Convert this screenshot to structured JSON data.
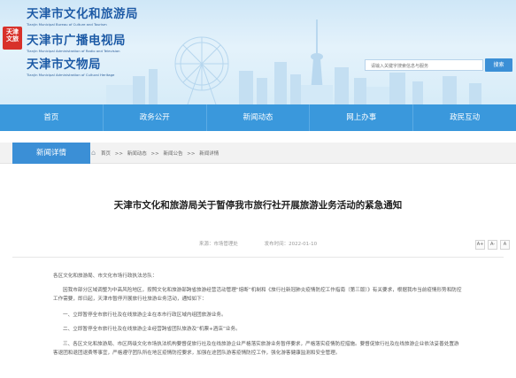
{
  "header": {
    "seal_text": "天津市文化和旅游局",
    "orgs": [
      {
        "cn": "天津市文化和旅游局",
        "en": "Tianjin Municipal Bureau of Culture and Tourism"
      },
      {
        "cn": "天津市广播电视局",
        "en": "Tianjin Municipal Administration of Radio and Television"
      },
      {
        "cn": "天津市文物局",
        "en": "Tianjin Municipal Administration of Cultural Heritage"
      }
    ],
    "search_placeholder": "请输入关键字搜索信息与服务",
    "search_button": "搜索"
  },
  "nav": {
    "items": [
      "首页",
      "政务公开",
      "新闻动态",
      "网上办事",
      "政民互动"
    ]
  },
  "breadcrumb": {
    "tab": "新闻详情",
    "items": [
      "首页",
      ">>",
      "新闻动态",
      ">>",
      "新闻公告",
      ">>",
      "新闻详情"
    ]
  },
  "article": {
    "title": "天津市文化和旅游局关于暂停我市旅行社开展旅游业务活动的紧急通知",
    "source": "来源：市场管理处",
    "date": "发布时间：2022-01-10",
    "font_tools": [
      "A+",
      "A-",
      "A"
    ],
    "paragraphs": [
      "各区文化和旅游局、市文化市场行政执法总队：",
      "因我市部分区域调整为中高风险地区，按照文化和旅游部跨省旅游经营活动管理“熔断”机制和《旅行社新冠肺炎疫情防控工作指南（第三版）》有关要求，根据我市当前疫情形势和防控工作需要，即日起，天津市暂停开展旅行社旅游业务活动，通知如下：",
      "一、立即暂停全市旅行社及在线旅游企业在本市行政区域内组团旅游业务。",
      "二、立即暂停全市旅行社及在线旅游企业经营跨省团队旅游及“机票+酒店”业务。",
      "三、各区文化和旅游局、市区两级文化市场执法机构要督促旅行社及在线旅游企业严格落实旅游业务暂停要求，严格落实疫情防控措施。要督促旅行社及在线旅游企业依法妥善处置游客退团和退团退费等事宜，严格遵守团队所在地区疫情防控要求，加强在途团队游客疫情防控工作，强化游客健康监测和安全管理。"
    ]
  }
}
